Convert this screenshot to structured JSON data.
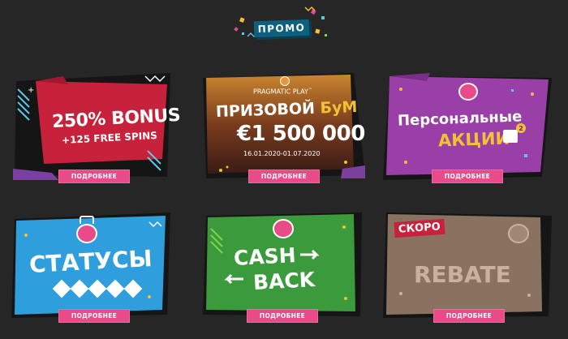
{
  "header": {
    "badge_label": "ПРОМО"
  },
  "cards": [
    {
      "line1": "250% BONUS",
      "line2": "+125 FREE SPINS",
      "button": "ПОДРОБНЕЕ"
    },
    {
      "logo_text": "PRAGMATIC PLAY",
      "logo_tm": "™",
      "title_a": "ПРИЗОВОЙ",
      "title_b": "БуМ",
      "amount": "€1 500 000",
      "dates": "16.01.2020-01.07.2020",
      "button": "ПОДРОБНЕЕ"
    },
    {
      "line1": "Персональные",
      "line2": "АКЦИИ",
      "gift_badge": "2",
      "button": "ПОДРОБНЕЕ"
    },
    {
      "title": "СТАТУСЫ",
      "button": "ПОДРОБНЕЕ"
    },
    {
      "line1": "CASH",
      "line2": "BACK",
      "button": "ПОДРОБНЕЕ"
    },
    {
      "ribbon": "СКОРО",
      "title": "REBATE",
      "button": "ПОДРОБНЕЕ"
    }
  ],
  "colors": {
    "background": "#262626",
    "button": "#e84b87",
    "badge": "#0f5f7e",
    "card1": "#c8213b",
    "card2": "#7a3c1e",
    "card3": "#9b3fa8",
    "card4": "#2f9edc",
    "card5": "#3a9a3c",
    "card6": "#8a7261"
  }
}
